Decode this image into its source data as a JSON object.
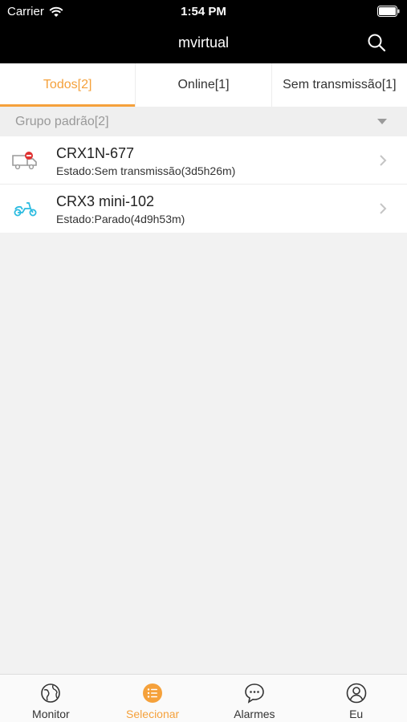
{
  "status_bar": {
    "carrier": "Carrier",
    "time": "1:54 PM"
  },
  "header": {
    "title": "mvirtual",
    "search_icon": "search-icon"
  },
  "tabs": [
    {
      "label": "Todos[2]",
      "active": true
    },
    {
      "label": "Online[1]",
      "active": false
    },
    {
      "label": "Sem transmissão[1]",
      "active": false
    }
  ],
  "group": {
    "label": "Grupo padrão[2]",
    "icon": "caret-down-icon"
  },
  "devices": [
    {
      "name": "CRX1N-677",
      "status": "Estado:Sem transmissão(3d5h26m)",
      "icon": "truck-offline-icon",
      "icon_color": "#9a9a9a",
      "badge_color": "#e03232"
    },
    {
      "name": "CRX3 mini-102",
      "status": "Estado:Parado(4d9h53m)",
      "icon": "scooter-icon",
      "icon_color": "#2bbbe0"
    }
  ],
  "bottom_nav": [
    {
      "label": "Monitor",
      "icon": "globe-icon",
      "active": false
    },
    {
      "label": "Selecionar",
      "icon": "list-icon",
      "active": true
    },
    {
      "label": "Alarmes",
      "icon": "chat-bubble-icon",
      "active": false
    },
    {
      "label": "Eu",
      "icon": "user-icon",
      "active": false
    }
  ],
  "colors": {
    "accent": "#f5a13b",
    "header_bg": "#000000",
    "page_bg": "#f2f2f2"
  }
}
